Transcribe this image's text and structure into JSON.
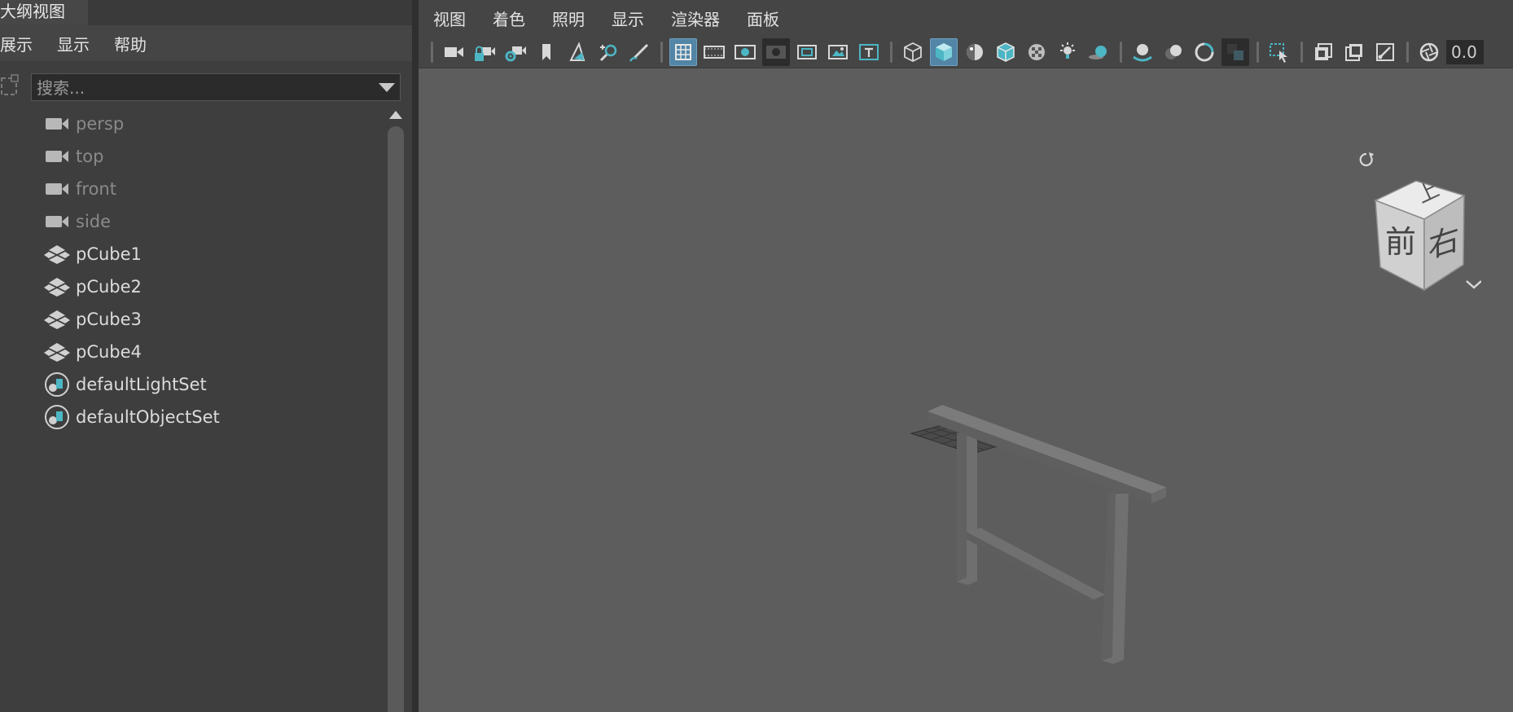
{
  "outliner": {
    "tab_title": "大纲视图",
    "menus": [
      "展示",
      "显示",
      "帮助"
    ],
    "search_placeholder": "搜索...",
    "items": [
      {
        "label": "persp",
        "type": "camera"
      },
      {
        "label": "top",
        "type": "camera"
      },
      {
        "label": "front",
        "type": "camera"
      },
      {
        "label": "side",
        "type": "camera"
      },
      {
        "label": "pCube1",
        "type": "mesh"
      },
      {
        "label": "pCube2",
        "type": "mesh"
      },
      {
        "label": "pCube3",
        "type": "mesh"
      },
      {
        "label": "pCube4",
        "type": "mesh"
      },
      {
        "label": "defaultLightSet",
        "type": "set"
      },
      {
        "label": "defaultObjectSet",
        "type": "set"
      }
    ]
  },
  "viewport": {
    "menus": [
      "视图",
      "着色",
      "照明",
      "显示",
      "渲染器",
      "面板"
    ],
    "frame_value": "0.0",
    "viewcube": {
      "top": "上",
      "front": "前",
      "right": "右"
    }
  },
  "colors": {
    "accent": "#5285a6",
    "icon_teal": "#4cb6c4",
    "viewport_bg": "#5d5d5d",
    "panel_bg": "#3e3e3e"
  },
  "toolbar_icons": [
    "camera-icon",
    "camera-lock-icon",
    "camera-attributes-icon",
    "bookmark-icon",
    "image-plane-icon",
    "2d-pan-zoom-icon",
    "grease-pencil-icon",
    "grid-icon",
    "film-gate-icon",
    "resolution-gate-icon",
    "gate-mask-icon",
    "field-chart-icon",
    "safe-action-icon",
    "safe-title-icon",
    "wireframe-icon",
    "smooth-shade-icon",
    "default-material-icon",
    "wireframe-on-shaded-icon",
    "textured-icon",
    "lights-icon",
    "shadows-icon",
    "screen-space-ao-icon",
    "motion-blur-icon",
    "multisample-aa-icon",
    "depth-of-field-icon",
    "isolate-select-icon",
    "xray-icon",
    "xray-active-components-icon",
    "xray-joints-icon",
    "exposure-icon"
  ]
}
